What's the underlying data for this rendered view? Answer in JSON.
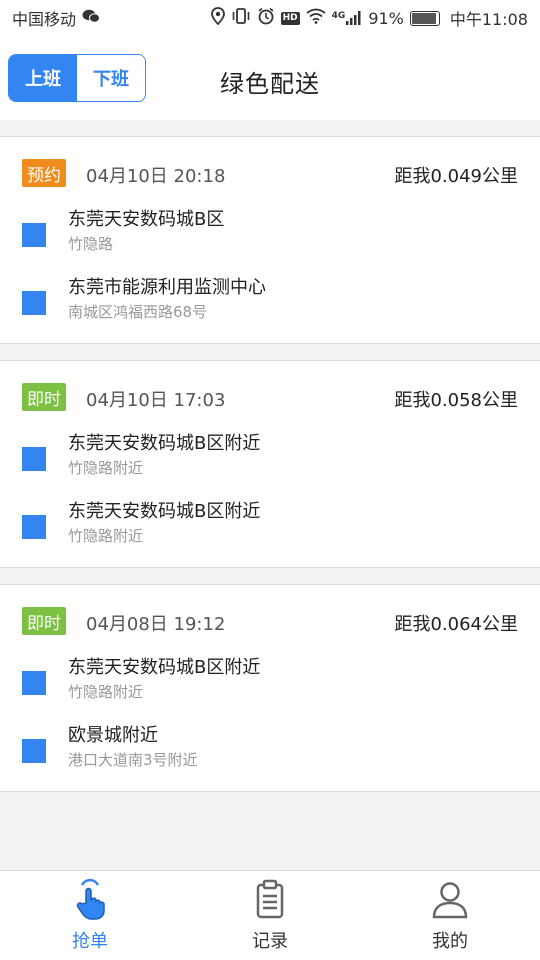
{
  "status_bar": {
    "carrier": "中国移动",
    "network": "4G",
    "battery": "91%",
    "time": "中午11:08"
  },
  "header": {
    "segments": [
      {
        "label": "上班",
        "active": true
      },
      {
        "label": "下班",
        "active": false
      }
    ],
    "title": "绿色配送"
  },
  "orders": [
    {
      "badge": "预约",
      "badge_color": "#f08c1e",
      "time": "04月10日 20:18",
      "distance": "距我0.049公里",
      "stops": [
        {
          "name": "东莞天安数码城B区",
          "address": "竹隐路"
        },
        {
          "name": "东莞市能源利用监测中心",
          "address": "南城区鸿福西路68号"
        }
      ]
    },
    {
      "badge": "即时",
      "badge_color": "#7cc144",
      "time": "04月10日 17:03",
      "distance": "距我0.058公里",
      "stops": [
        {
          "name": "东莞天安数码城B区附近",
          "address": "竹隐路附近"
        },
        {
          "name": "东莞天安数码城B区附近",
          "address": "竹隐路附近"
        }
      ]
    },
    {
      "badge": "即时",
      "badge_color": "#7cc144",
      "time": "04月08日 19:12",
      "distance": "距我0.064公里",
      "stops": [
        {
          "name": "东莞天安数码城B区附近",
          "address": "竹隐路附近"
        },
        {
          "name": "欧景城附近",
          "address": "港口大道南3号附近"
        }
      ]
    }
  ],
  "tabs": [
    {
      "label": "抢单",
      "icon": "tap-hand-icon",
      "active": true
    },
    {
      "label": "记录",
      "icon": "clipboard-icon",
      "active": false
    },
    {
      "label": "我的",
      "icon": "user-icon",
      "active": false
    }
  ],
  "colors": {
    "accent": "#3385f1",
    "badge_scheduled": "#f08c1e",
    "badge_instant": "#7cc144"
  }
}
